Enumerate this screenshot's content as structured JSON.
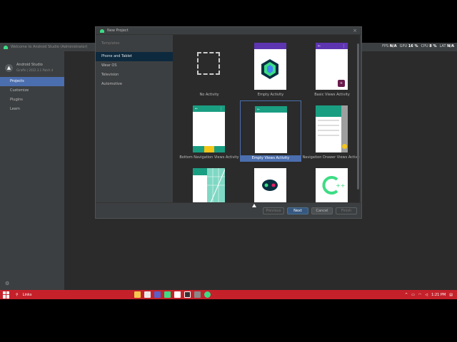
{
  "window": {
    "title": "Welcome to Android Studio (Administrator)"
  },
  "perf_overlay": [
    {
      "label": "FPS",
      "value": "N/A"
    },
    {
      "label": "GPU",
      "value": "16 %"
    },
    {
      "label": "CPU",
      "value": "8 %"
    },
    {
      "label": "LAT",
      "value": "N/A"
    }
  ],
  "welcome": {
    "app_name": "Android Studio",
    "version": "Giraffe | 2022.3.1 Patch 4",
    "nav": [
      "Projects",
      "Customize",
      "Plugins",
      "Learn"
    ],
    "active_nav": 0
  },
  "dialog": {
    "title": "New Project",
    "categories_header": "Templates",
    "categories": [
      "Phone and Tablet",
      "Wear OS",
      "Television",
      "Automotive"
    ],
    "active_category": 0,
    "templates": [
      {
        "label": "No Activity"
      },
      {
        "label": "Empty Activity"
      },
      {
        "label": "Basic Views Activity"
      },
      {
        "label": "Bottom Navigation Views Activity"
      },
      {
        "label": "Empty Views Activity"
      },
      {
        "label": "Navigation Drawer Views Activity"
      },
      {
        "label": ""
      },
      {
        "label": ""
      },
      {
        "label": ""
      }
    ],
    "selected_template": 4,
    "buttons": {
      "previous": "Previous",
      "next": "Next",
      "cancel": "Cancel",
      "finish": "Finish"
    }
  },
  "taskbar": {
    "search_text": "Links",
    "time": "1:21 PM"
  },
  "colors": {
    "accent": "#4b6eaf",
    "toolbar_purple": "#5e35b1",
    "toolbar_teal": "#1a9e82",
    "taskbar_red": "#c5212b"
  }
}
